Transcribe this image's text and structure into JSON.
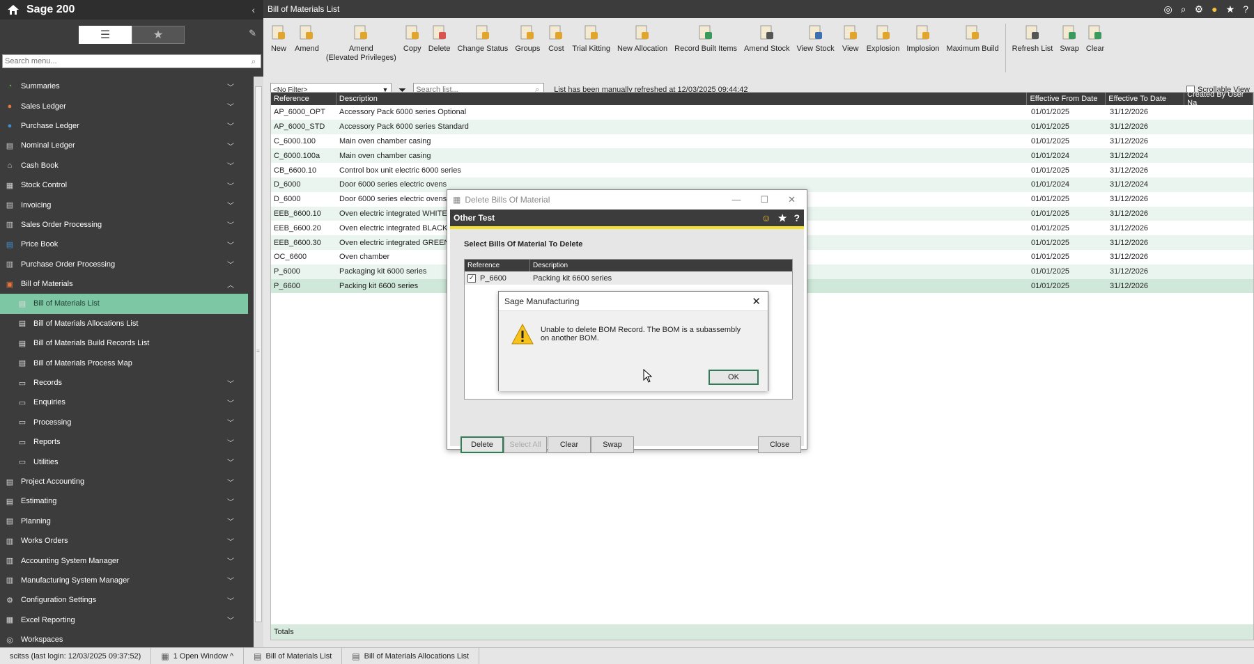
{
  "app": {
    "title": "Sage 200"
  },
  "sidebar": {
    "search_placeholder": "Search menu...",
    "items": [
      {
        "label": "Summaries",
        "icon": "pie-chart-icon",
        "color": "#6ab04c"
      },
      {
        "label": "Sales Ledger",
        "icon": "person-icon",
        "color": "#e8763a"
      },
      {
        "label": "Purchase Ledger",
        "icon": "people-icon",
        "color": "#3e8ed0"
      },
      {
        "label": "Nominal Ledger",
        "icon": "book-icon",
        "color": "#cccccc"
      },
      {
        "label": "Cash Book",
        "icon": "bank-icon",
        "color": "#cccccc"
      },
      {
        "label": "Stock Control",
        "icon": "boxes-icon",
        "color": "#cccccc"
      },
      {
        "label": "Invoicing",
        "icon": "invoice-icon",
        "color": "#cccccc"
      },
      {
        "label": "Sales Order Processing",
        "icon": "sales-order-icon",
        "color": "#cccccc"
      },
      {
        "label": "Price Book",
        "icon": "price-book-icon",
        "color": "#3e8ed0"
      },
      {
        "label": "Purchase Order Processing",
        "icon": "purchase-order-icon",
        "color": "#cccccc"
      },
      {
        "label": "Bill of Materials",
        "icon": "bom-icon",
        "color": "#e8763a"
      }
    ],
    "bom_children": [
      "Bill of Materials List",
      "Bill of Materials Allocations List",
      "Bill of Materials Build Records List",
      "Bill of Materials Process Map"
    ],
    "bom_folders": [
      "Records",
      "Enquiries",
      "Processing",
      "Reports",
      "Utilities"
    ],
    "bottom_items": [
      {
        "label": "Project Accounting",
        "icon": "project-icon"
      },
      {
        "label": "Estimating",
        "icon": "estimating-icon"
      },
      {
        "label": "Planning",
        "icon": "planning-icon"
      },
      {
        "label": "Works Orders",
        "icon": "works-orders-icon"
      },
      {
        "label": "Accounting System Manager",
        "icon": "accounting-manager-icon"
      },
      {
        "label": "Manufacturing System Manager",
        "icon": "manufacturing-manager-icon"
      },
      {
        "label": "Configuration Settings",
        "icon": "config-icon"
      },
      {
        "label": "Excel Reporting",
        "icon": "excel-icon"
      },
      {
        "label": "Workspaces",
        "icon": "globe-icon"
      }
    ]
  },
  "header": {
    "title": "Bill of Materials List"
  },
  "toolbar": [
    {
      "label": "New",
      "icon": "new-icon"
    },
    {
      "label": "Amend",
      "icon": "amend-icon"
    },
    {
      "label": "Amend\n(Elevated Privileges)",
      "icon": "amend-elevated-icon"
    },
    {
      "label": "Copy",
      "icon": "copy-icon"
    },
    {
      "label": "Delete",
      "icon": "delete-icon"
    },
    {
      "label": "Change Status",
      "icon": "change-status-icon"
    },
    {
      "label": "Groups",
      "icon": "groups-icon"
    },
    {
      "label": "Cost",
      "icon": "cost-icon"
    },
    {
      "label": "Trial Kitting",
      "icon": "trial-kitting-icon"
    },
    {
      "label": "New Allocation",
      "icon": "new-allocation-icon"
    },
    {
      "label": "Record Built Items",
      "icon": "record-built-icon"
    },
    {
      "label": "Amend Stock",
      "icon": "amend-stock-icon"
    },
    {
      "label": "View Stock",
      "icon": "view-stock-icon"
    },
    {
      "label": "View",
      "icon": "view-icon"
    },
    {
      "label": "Explosion",
      "icon": "explosion-icon"
    },
    {
      "label": "Implosion",
      "icon": "implosion-icon"
    },
    {
      "label": "Maximum Build",
      "icon": "maximum-build-icon"
    },
    {
      "label": "Refresh List",
      "icon": "refresh-icon"
    },
    {
      "label": "Swap",
      "icon": "swap-icon"
    },
    {
      "label": "Clear",
      "icon": "clear-icon"
    }
  ],
  "filter": {
    "selected": "<No Filter>",
    "search_placeholder": "Search list...",
    "refresh_note": "List has been manually refreshed at 12/03/2025 09:44:42",
    "scrollable_view": "Scrollable View"
  },
  "grid": {
    "columns": [
      "Reference",
      "Description",
      "Effective From Date",
      "Effective To Date",
      "Created By User Na"
    ],
    "rows": [
      [
        "AP_6000_OPT",
        "Accessory Pack 6000 series Optional",
        "01/01/2025",
        "31/12/2026"
      ],
      [
        "AP_6000_STD",
        "Accessory Pack 6000 series Standard",
        "01/01/2025",
        "31/12/2026"
      ],
      [
        "C_6000.100",
        "Main oven chamber casing",
        "01/01/2025",
        "31/12/2026"
      ],
      [
        "C_6000.100a",
        "Main oven chamber casing",
        "01/01/2024",
        "31/12/2024"
      ],
      [
        "CB_6600.10",
        "Control box unit electric 6000 series",
        "01/01/2025",
        "31/12/2026"
      ],
      [
        "D_6000",
        "Door 6000 series electric ovens",
        "01/01/2024",
        "31/12/2024"
      ],
      [
        "D_6000",
        "Door 6000 series electric ovens",
        "01/01/2025",
        "31/12/2026"
      ],
      [
        "EEB_6600.10",
        "Oven electric integrated WHITE",
        "01/01/2025",
        "31/12/2026"
      ],
      [
        "EEB_6600.20",
        "Oven electric integrated BLACK",
        "01/01/2025",
        "31/12/2026"
      ],
      [
        "EEB_6600.30",
        "Oven electric integrated GREEN",
        "01/01/2025",
        "31/12/2026"
      ],
      [
        "OC_6600",
        "Oven chamber",
        "01/01/2025",
        "31/12/2026"
      ],
      [
        "P_6000",
        "Packaging kit 6000 series",
        "01/01/2025",
        "31/12/2026"
      ],
      [
        "P_6600",
        "Packing kit 6600 series",
        "01/01/2025",
        "31/12/2026"
      ]
    ],
    "totals_label": "Totals"
  },
  "delete_dialog": {
    "window_title": "Delete Bills Of Material",
    "header": "Other Test",
    "caption": "Select Bills Of Material To Delete",
    "columns": [
      "Reference",
      "Description"
    ],
    "row": {
      "reference": "P_6600",
      "description": "Packing kit 6600 series"
    },
    "buttons": {
      "delete": "Delete",
      "select_all": "Select All",
      "clear": "Clear",
      "swap": "Swap",
      "close": "Close"
    }
  },
  "message_box": {
    "title": "Sage Manufacturing",
    "text": "Unable to delete BOM Record. The BOM is a subassembly on another BOM.",
    "ok": "OK"
  },
  "statusbar": {
    "user": "scitss (last login: 12/03/2025 09:37:52)",
    "windows": "1 Open Window ^",
    "tab1": "Bill of Materials List",
    "tab2": "Bill of Materials Allocations List"
  },
  "colors": {
    "accent": "#7dc7a5",
    "dark": "#3c3c3c",
    "yellow": "#f3e129",
    "ok_border": "#2f7d56"
  }
}
